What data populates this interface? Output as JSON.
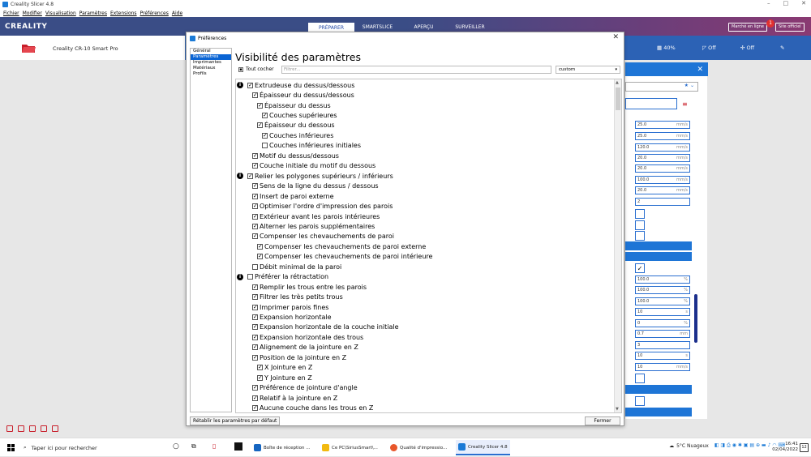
{
  "window": {
    "title": "Creality Slicer 4.8",
    "minimize": "–",
    "maximize": "□",
    "close": "✕"
  },
  "menu": [
    "Fichier",
    "Modifier",
    "Visualisation",
    "Paramètres",
    "Extensions",
    "Préférences",
    "Aide"
  ],
  "topbar": {
    "logo": "CREALITY",
    "stages": [
      "PRÉPARER",
      "SMARTSLICE",
      "APERÇU",
      "SURVEILLER"
    ],
    "active_stage": "PRÉPARER",
    "market_label": "Marché en ligne",
    "market_badge": "1",
    "site_label": "Site officiel"
  },
  "printer": {
    "name": "Creality CR-10 Smart Pro",
    "infill": "40%",
    "support": "Off",
    "adhesion": "Off"
  },
  "side_panel": {
    "close": "✕",
    "values": [
      {
        "v": "25.0",
        "u": "mm/s"
      },
      {
        "v": "25.0",
        "u": "mm/s"
      },
      {
        "v": "120.0",
        "u": "mm/s"
      },
      {
        "v": "20.0",
        "u": "mm/s"
      },
      {
        "v": "20.0",
        "u": "mm/s"
      },
      {
        "v": "100.0",
        "u": "mm/s"
      },
      {
        "v": "20.0",
        "u": "mm/s"
      },
      {
        "v": "2",
        "u": ""
      }
    ],
    "values2": [
      {
        "v": "100.0",
        "u": "%"
      },
      {
        "v": "100.0",
        "u": "%"
      },
      {
        "v": "100.0",
        "u": "%"
      },
      {
        "v": "10",
        "u": "s"
      },
      {
        "v": "0",
        "u": "%"
      },
      {
        "v": "0.7",
        "u": "mm"
      },
      {
        "v": "3",
        "u": ""
      },
      {
        "v": "10",
        "u": "s"
      },
      {
        "v": "10",
        "u": "mm/s"
      }
    ],
    "check": "✓"
  },
  "dialog": {
    "title": "Préférences",
    "close": "✕",
    "nav": [
      "Général",
      "Paramètres",
      "Imprimantes",
      "Matériaux",
      "Profils"
    ],
    "nav_selected": 1,
    "heading": "Visibilité des paramètres",
    "check_all": "Tout cocher",
    "filter_placeholder": "Filtrer...",
    "preset": "custom",
    "reset_button": "Rétablir les paramètres par défaut",
    "close_button": "Fermer",
    "settings": [
      {
        "label": "Extrudeuse du dessus/dessous",
        "checked": true,
        "indent": 0,
        "info": true
      },
      {
        "label": "Épaisseur du dessus/dessous",
        "checked": true,
        "indent": 1,
        "info": false
      },
      {
        "label": "Épaisseur du dessus",
        "checked": true,
        "indent": 2,
        "info": false
      },
      {
        "label": "Couches supérieures",
        "checked": true,
        "indent": 3,
        "info": false
      },
      {
        "label": "Épaisseur du dessous",
        "checked": true,
        "indent": 2,
        "info": false
      },
      {
        "label": "Couches inférieures",
        "checked": true,
        "indent": 3,
        "info": false
      },
      {
        "label": "Couches inférieures initiales",
        "checked": false,
        "indent": 3,
        "info": false
      },
      {
        "label": "Motif du dessus/dessous",
        "checked": true,
        "indent": 1,
        "info": false
      },
      {
        "label": "Couche initiale du motif du dessous",
        "checked": true,
        "indent": 1,
        "info": false
      },
      {
        "label": "Relier les polygones supérieurs / inférieurs",
        "checked": true,
        "indent": 0,
        "info": true
      },
      {
        "label": "Sens de la ligne du dessus / dessous",
        "checked": true,
        "indent": 1,
        "info": false
      },
      {
        "label": "Insert de paroi externe",
        "checked": true,
        "indent": 1,
        "info": false
      },
      {
        "label": "Optimiser l'ordre d'impression des parois",
        "checked": true,
        "indent": 1,
        "info": false
      },
      {
        "label": "Extérieur avant les parois intérieures",
        "checked": true,
        "indent": 1,
        "info": false
      },
      {
        "label": "Alterner les parois supplémentaires",
        "checked": true,
        "indent": 1,
        "info": false
      },
      {
        "label": "Compenser les chevauchements de paroi",
        "checked": true,
        "indent": 1,
        "info": false
      },
      {
        "label": "Compenser les chevauchements de paroi externe",
        "checked": true,
        "indent": 2,
        "info": false
      },
      {
        "label": "Compenser les chevauchements de paroi intérieure",
        "checked": true,
        "indent": 2,
        "info": false
      },
      {
        "label": "Débit minimal de la paroi",
        "checked": false,
        "indent": 1,
        "info": false
      },
      {
        "label": "Préférer la rétractation",
        "checked": false,
        "indent": 0,
        "info": true
      },
      {
        "label": "Remplir les trous entre les parois",
        "checked": true,
        "indent": 1,
        "info": false
      },
      {
        "label": "Filtrer les très petits trous",
        "checked": true,
        "indent": 1,
        "info": false
      },
      {
        "label": "Imprimer parois fines",
        "checked": true,
        "indent": 1,
        "info": false
      },
      {
        "label": "Expansion horizontale",
        "checked": true,
        "indent": 1,
        "info": false
      },
      {
        "label": "Expansion horizontale de la couche initiale",
        "checked": true,
        "indent": 1,
        "info": false
      },
      {
        "label": "Expansion horizontale des trous",
        "checked": true,
        "indent": 1,
        "info": false
      },
      {
        "label": "Alignement de la jointure en Z",
        "checked": true,
        "indent": 1,
        "info": false
      },
      {
        "label": "Position de la jointure en Z",
        "checked": true,
        "indent": 1,
        "info": false
      },
      {
        "label": "X Jointure en Z",
        "checked": true,
        "indent": 2,
        "info": false
      },
      {
        "label": "Y Jointure en Z",
        "checked": true,
        "indent": 2,
        "info": false
      },
      {
        "label": "Préférence de jointure d'angle",
        "checked": true,
        "indent": 1,
        "info": false
      },
      {
        "label": "Relatif à la jointure en Z",
        "checked": true,
        "indent": 1,
        "info": false
      },
      {
        "label": "Aucune couche dans les trous en Z",
        "checked": true,
        "indent": 1,
        "info": false
      }
    ]
  },
  "taskbar": {
    "search_placeholder": "Taper ici pour rechercher",
    "apps": [
      {
        "label": "Boîte de réception ...",
        "color": "#1565c0"
      },
      {
        "label": "Ce PC\\SiriusSmart\\...",
        "color": "#f2b90f"
      },
      {
        "label": "Qualité d'impressio...",
        "color": "#e8562a"
      },
      {
        "label": "Creality Slicer 4.8",
        "color": "#1a7ad6"
      }
    ],
    "weather": "5°C Nuageux",
    "time": "16:41",
    "date": "02/04/2022",
    "notif": "12"
  },
  "colors": {
    "accent": "#1e75d6",
    "topbar": "#3a4d86",
    "printerbar": "#2c62b5",
    "selected": "#0a64d4"
  }
}
